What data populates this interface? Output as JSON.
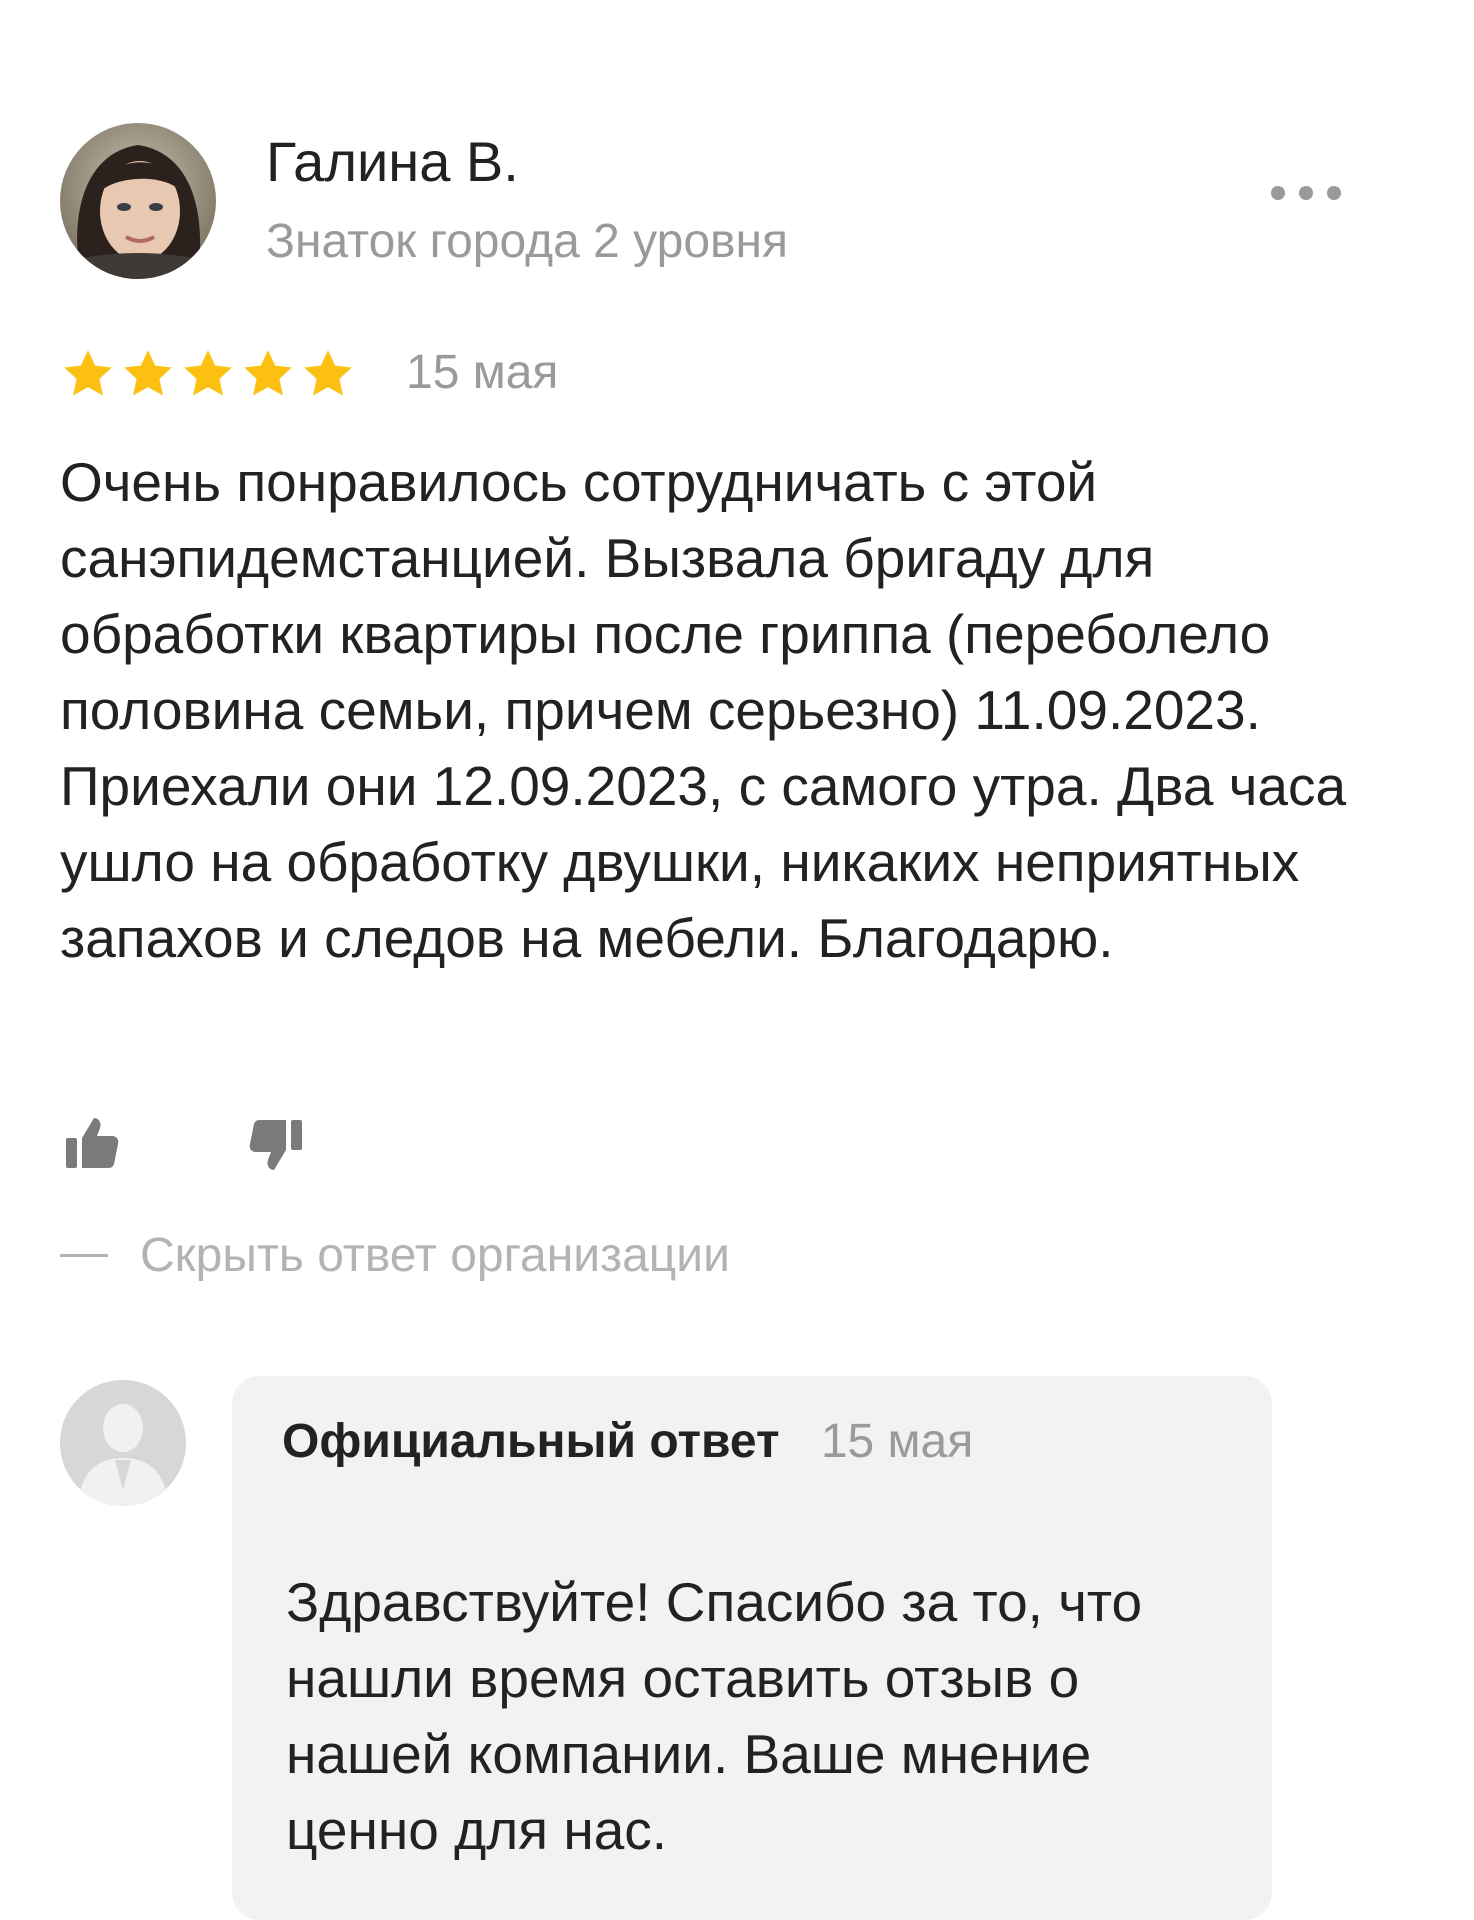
{
  "review": {
    "author_name": "Галина В.",
    "author_level": "Знаток города 2 уровня",
    "rating": 5,
    "rating_max": 5,
    "date": "15 мая",
    "text": "Очень понравилось сотрудничать с этой санэпидемстанцией. Вызвала бригаду для обработки квартиры после гриппа (переболело половина семьи, причем серьезно) 11.09.2023. Приехали они 12.09.2023, с самого утра. Два часа ушло на обработку двушки, никаких неприятных запахов и следов на мебели. Благодарю."
  },
  "actions": {
    "hide_reply_label": "Скрыть ответ организации"
  },
  "reply": {
    "title": "Официальный ответ",
    "date": "15 мая",
    "text": "Здравствуйте! Спасибо за то, что нашли время оставить отзыв о нашей компании. Ваше мнение ценно для нас."
  },
  "colors": {
    "star": "#FCC110",
    "muted_text": "#9a9a9a",
    "reply_background": "#f2f2f2"
  },
  "icons": {
    "more": "more-dots-icon",
    "like": "thumbs-up-icon",
    "dislike": "thumbs-down-icon"
  }
}
